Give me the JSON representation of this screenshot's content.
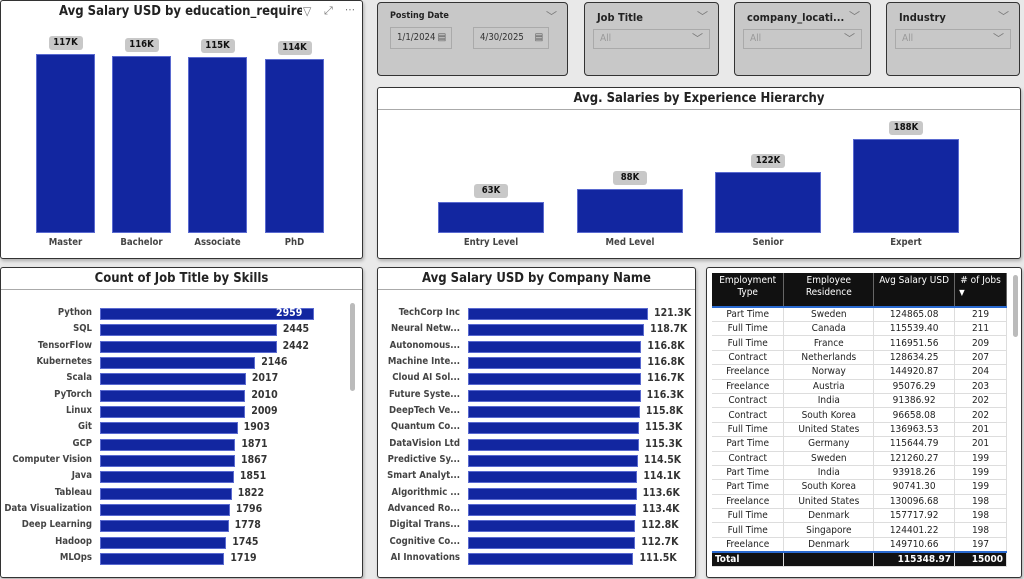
{
  "colors": {
    "bar": "#1226a0",
    "badge": "#c8c8c8",
    "filter_bg": "#c8c8c8"
  },
  "education_chart": {
    "title": "Avg Salary USD by education_required",
    "icons": [
      "filter-icon",
      "focus-mode-icon",
      "more-options-icon"
    ]
  },
  "filters": {
    "posting_date": {
      "label": "Posting Date",
      "start": "1/1/2024",
      "end": "4/30/2025"
    },
    "job_title": {
      "label": "Job Title",
      "value": "All"
    },
    "company_location": {
      "label": "company_locati...",
      "value": "All"
    },
    "industry": {
      "label": "Industry",
      "value": "All"
    }
  },
  "experience_chart": {
    "title": "Avg. Salaries by Experience Hierarchy"
  },
  "skills_chart": {
    "title": "Count of Job Title by Skills"
  },
  "company_chart": {
    "title": "Avg Salary USD by Company Name"
  },
  "chart_data": [
    {
      "type": "bar",
      "title": "Avg Salary USD by education_required",
      "categories": [
        "Master",
        "Bachelor",
        "Associate",
        "PhD"
      ],
      "values": [
        117000,
        116000,
        115000,
        114000
      ],
      "labels": [
        "117K",
        "116K",
        "115K",
        "114K"
      ]
    },
    {
      "type": "bar",
      "title": "Avg. Salaries by Experience Hierarchy",
      "categories": [
        "Entry Level",
        "Med Level",
        "Senior",
        "Expert"
      ],
      "values": [
        63000,
        88000,
        122000,
        188000
      ],
      "labels": [
        "63K",
        "88K",
        "122K",
        "188K"
      ]
    },
    {
      "type": "bar",
      "orientation": "horizontal",
      "title": "Count of Job Title by Skills",
      "categories": [
        "Python",
        "SQL",
        "TensorFlow",
        "Kubernetes",
        "Scala",
        "PyTorch",
        "Linux",
        "Git",
        "GCP",
        "Computer Vision",
        "Java",
        "Tableau",
        "Data Visualization",
        "Deep Learning",
        "Hadoop",
        "MLOps"
      ],
      "values": [
        2959,
        2445,
        2442,
        2146,
        2017,
        2010,
        2009,
        1903,
        1871,
        1867,
        1851,
        1822,
        1796,
        1778,
        1745,
        1719
      ],
      "labels": [
        "2959",
        "2445",
        "2442",
        "2146",
        "2017",
        "2010",
        "2009",
        "1903",
        "1871",
        "1867",
        "1851",
        "1822",
        "1796",
        "1778",
        "1745",
        "1719"
      ]
    },
    {
      "type": "bar",
      "orientation": "horizontal",
      "title": "Avg Salary USD by Company Name",
      "categories": [
        "TechCorp Inc",
        "Neural Netw...",
        "Autonomous...",
        "Machine Inte...",
        "Cloud AI Sol...",
        "Future Syste...",
        "DeepTech Ve...",
        "Quantum Co...",
        "DataVision Ltd",
        "Predictive Sy...",
        "Smart Analyt...",
        "Algorithmic ...",
        "Advanced Ro...",
        "Digital Trans...",
        "Cognitive Co...",
        "AI Innovations"
      ],
      "values": [
        121300,
        118700,
        116800,
        116800,
        116700,
        116300,
        115800,
        115300,
        115300,
        114500,
        114100,
        113600,
        113400,
        112800,
        112700,
        111500
      ],
      "labels": [
        "121.3K",
        "118.7K",
        "116.8K",
        "116.8K",
        "116.7K",
        "116.3K",
        "115.8K",
        "115.3K",
        "115.3K",
        "114.5K",
        "114.1K",
        "113.6K",
        "113.4K",
        "112.8K",
        "112.7K",
        "111.5K"
      ]
    }
  ],
  "table": {
    "headers": [
      "Employment Type",
      "Employee Residence",
      "Avg Salary USD",
      "# of Jobs"
    ],
    "sort_icon": "sort-descending-icon",
    "rows": [
      [
        "Part Time",
        "Sweden",
        "124865.08",
        "219"
      ],
      [
        "Full Time",
        "Canada",
        "115539.40",
        "211"
      ],
      [
        "Full Time",
        "France",
        "116951.56",
        "209"
      ],
      [
        "Contract",
        "Netherlands",
        "128634.25",
        "207"
      ],
      [
        "Freelance",
        "Norway",
        "144920.87",
        "204"
      ],
      [
        "Freelance",
        "Austria",
        "95076.29",
        "203"
      ],
      [
        "Contract",
        "India",
        "91386.92",
        "202"
      ],
      [
        "Contract",
        "South Korea",
        "96658.08",
        "202"
      ],
      [
        "Full Time",
        "United States",
        "136963.53",
        "201"
      ],
      [
        "Part Time",
        "Germany",
        "115644.79",
        "201"
      ],
      [
        "Contract",
        "Sweden",
        "121260.27",
        "199"
      ],
      [
        "Part Time",
        "India",
        "93918.26",
        "199"
      ],
      [
        "Part Time",
        "South Korea",
        "90741.30",
        "199"
      ],
      [
        "Freelance",
        "United States",
        "130096.68",
        "198"
      ],
      [
        "Full Time",
        "Denmark",
        "157717.92",
        "198"
      ],
      [
        "Full Time",
        "Singapore",
        "124401.22",
        "198"
      ],
      [
        "Freelance",
        "Denmark",
        "149710.66",
        "197"
      ]
    ],
    "total": {
      "label": "Total",
      "avg_salary": "115348.97",
      "jobs": "15000"
    }
  }
}
